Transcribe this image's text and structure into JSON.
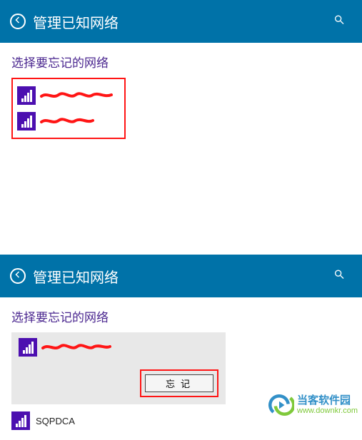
{
  "header": {
    "title": "管理已知网络"
  },
  "section_title": "选择要忘记的网络",
  "panel1": {
    "networks": [
      {
        "name_redacted": true
      },
      {
        "name_redacted": true
      }
    ]
  },
  "panel2": {
    "selected_network": {
      "name_redacted": true
    },
    "forget_button_label": "忘记",
    "second_network_name": "SQPDCA"
  },
  "icons": {
    "back": "back-arrow-icon",
    "search": "search-icon",
    "signal": "wifi-signal-icon"
  },
  "colors": {
    "header_bg": "#0072a8",
    "accent_purple": "#4c0fb0",
    "section_title": "#4a268f",
    "highlight_border": "#ff1515"
  },
  "watermark": {
    "name_cn": "当客软件园",
    "url": "www.downkr.com"
  }
}
